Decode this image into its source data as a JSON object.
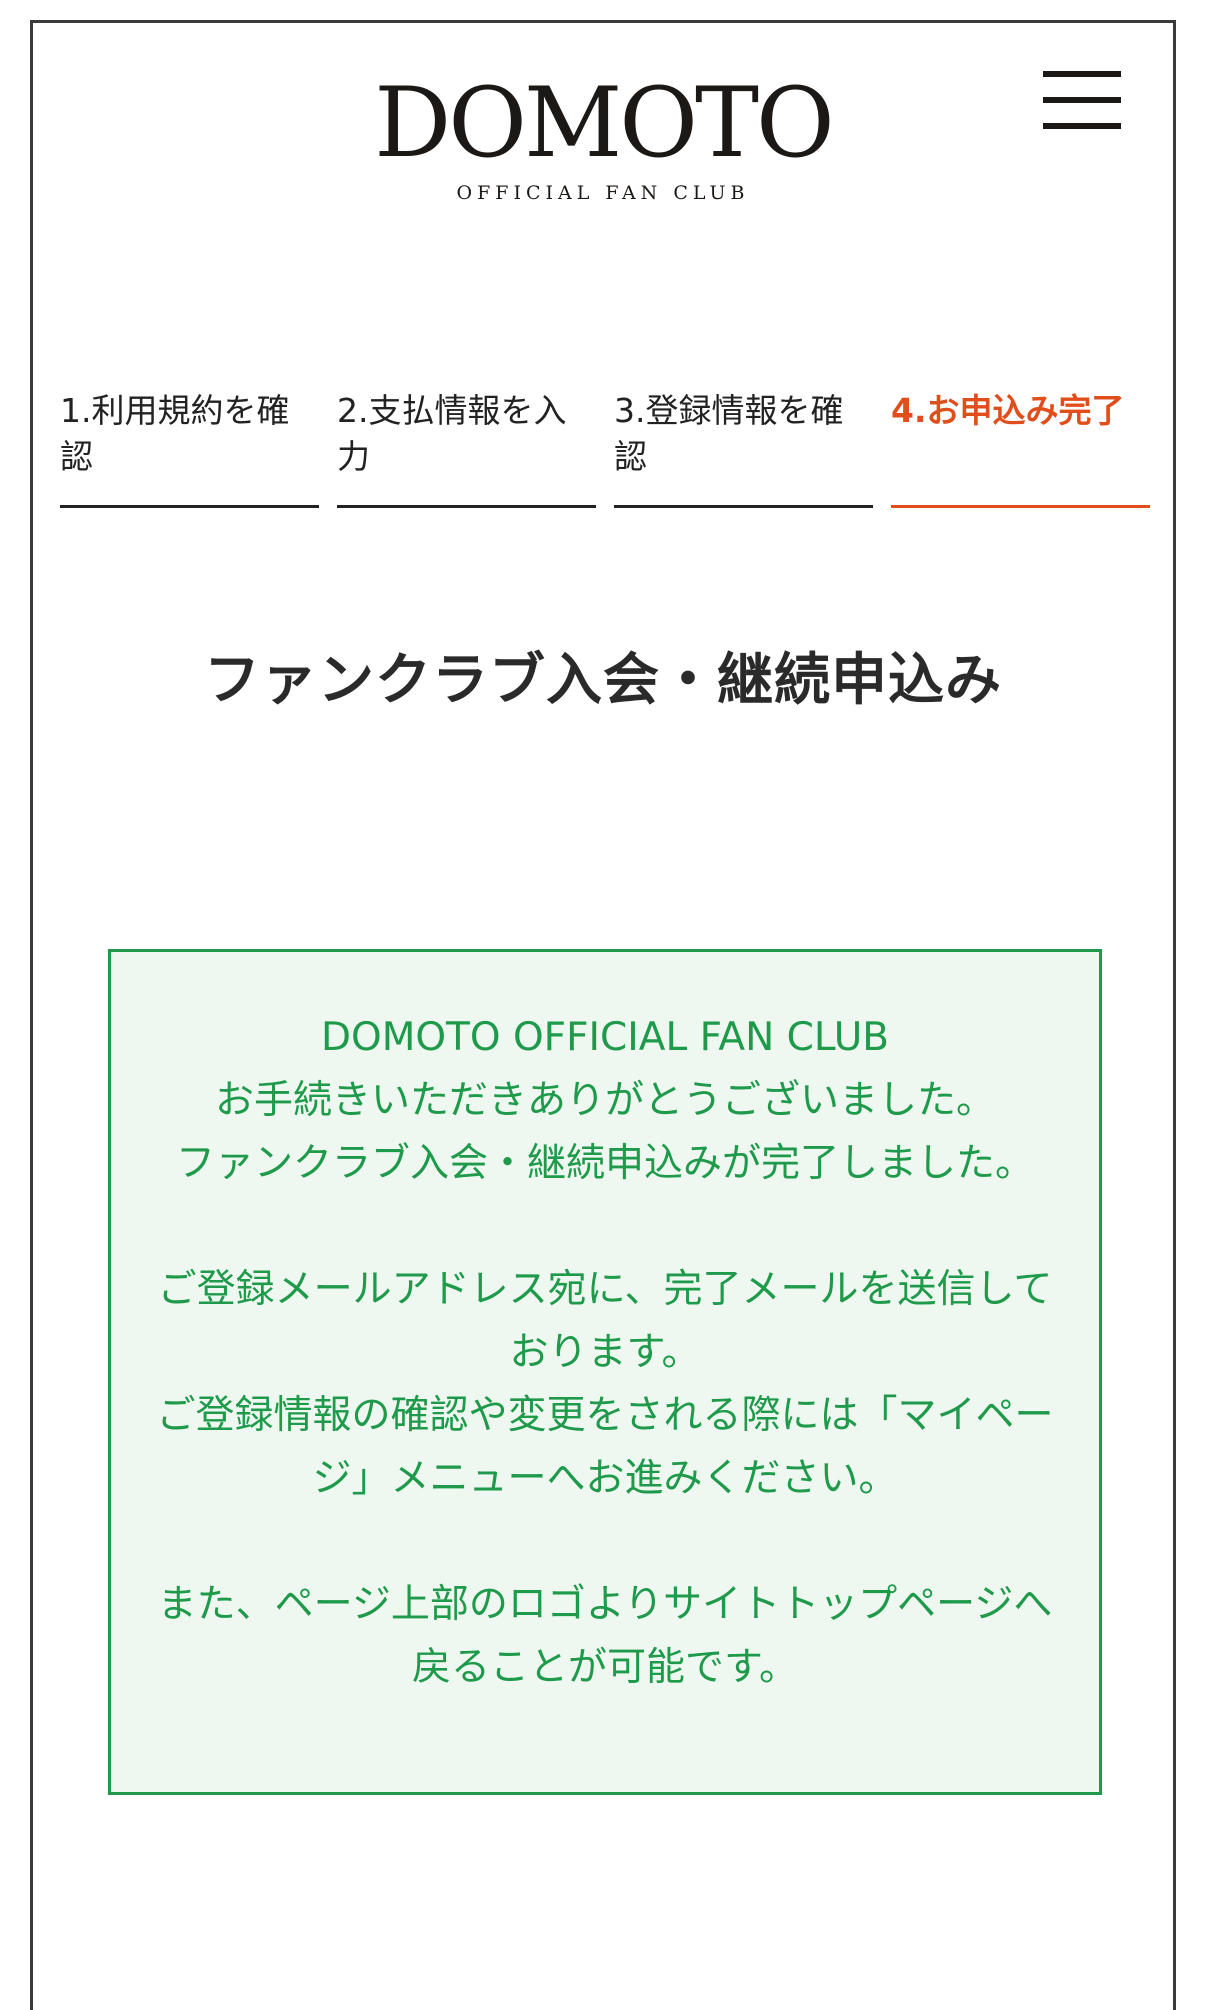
{
  "header": {
    "logo_main": "DOMOTO",
    "logo_sub": "OFFICIAL FAN CLUB",
    "menu_icon": "hamburger-menu-icon"
  },
  "steps": [
    {
      "label": "1.利用規約を確認",
      "active": false
    },
    {
      "label": "2.支払情報を入力",
      "active": false
    },
    {
      "label": "3.登録情報を確認",
      "active": false
    },
    {
      "label": "4.お申込み完了",
      "active": true
    }
  ],
  "page_title": "ファンクラブ入会・継続申込み",
  "message": {
    "line1": "DOMOTO OFFICIAL FAN CLUB",
    "line2": "お手続きいただきありがとうございました。",
    "line3": "ファンクラブ入会・継続申込みが完了しました。",
    "line4": "ご登録メールアドレス宛に、完了メールを送信しております。",
    "line5": "ご登録情報の確認や変更をされる際には「マイページ」メニューへお進みください。",
    "line6": "また、ページ上部のロゴよりサイトトップページへ戻ることが可能です。"
  },
  "colors": {
    "active_step": "#e04e1b",
    "message_text": "#1e9a4a",
    "message_border": "#1e9a4a",
    "message_bg": "#eef8f1"
  }
}
